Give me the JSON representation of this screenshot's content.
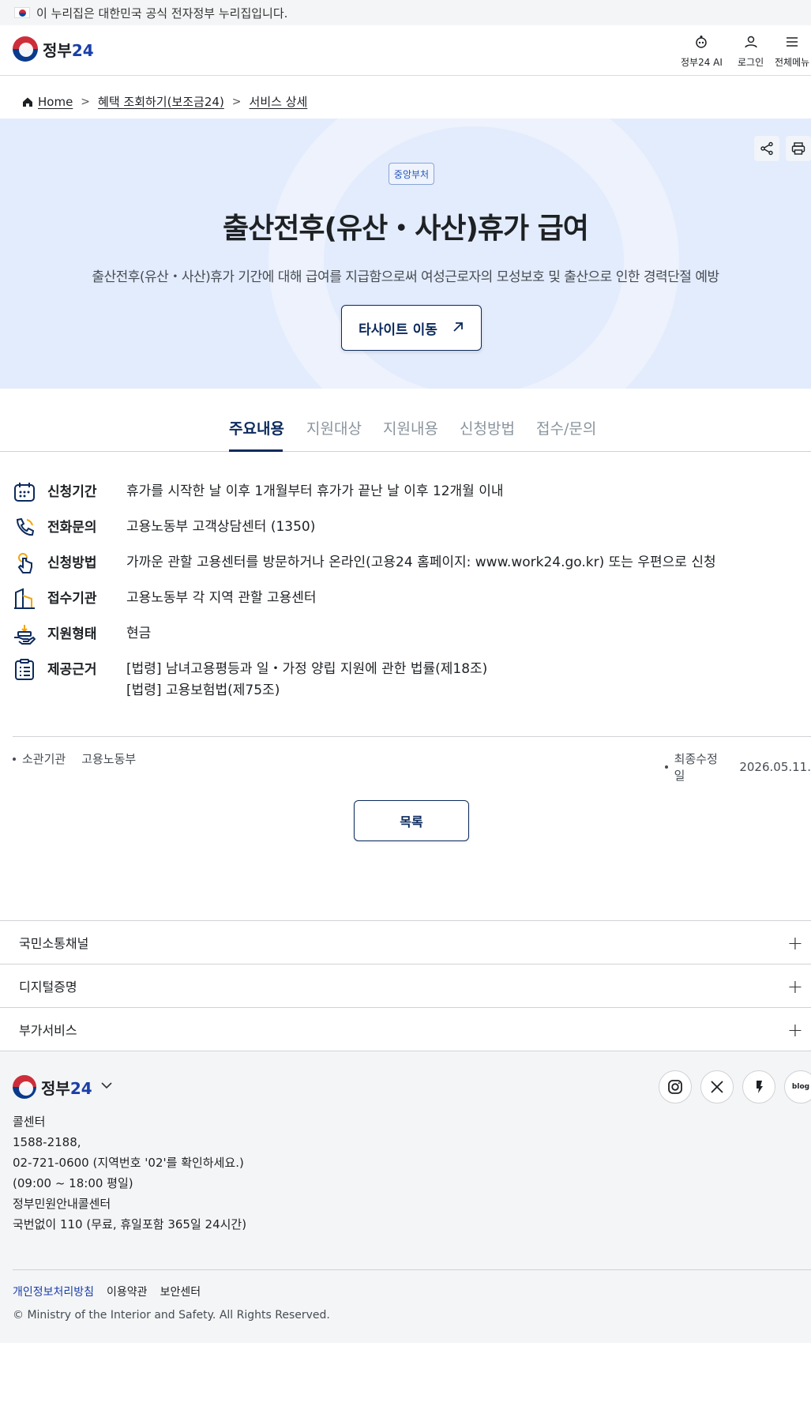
{
  "topbar": {
    "text": "이 누리집은 대한민국 공식 전자정부 누리집입니다."
  },
  "header": {
    "logo_text": "정부",
    "logo_num": "24",
    "ai_label": "정부24 AI",
    "login_label": "로그인",
    "menu_label": "전체메뉴"
  },
  "breadcrumb": {
    "home": "Home",
    "item1": "혜택 조회하기(보조금24)",
    "item2": "서비스 상세"
  },
  "hero": {
    "badge": "중앙부처",
    "title": "출산전후(유산・사산)휴가 급여",
    "description": "출산전후(유산・사산)휴가 기간에 대해 급여를 지급함으로써 여성근로자의 모성보호 및 출산으로 인한 경력단절 예방",
    "button_label": "타사이트 이동"
  },
  "tabs": [
    {
      "label": "주요내용"
    },
    {
      "label": "지원대상"
    },
    {
      "label": "지원내용"
    },
    {
      "label": "신청방법"
    },
    {
      "label": "접수/문의"
    }
  ],
  "info": [
    {
      "label": "신청기간",
      "value": "휴가를 시작한 날 이후 1개월부터 휴가가 끝난 날 이후 12개월 이내"
    },
    {
      "label": "전화문의",
      "value": "고용노동부 고객상담센터 (1350)"
    },
    {
      "label": "신청방법",
      "value": "가까운 관할 고용센터를 방문하거나 온라인(고용24 홈페이지: www.work24.go.kr) 또는 우편으로 신청"
    },
    {
      "label": "접수기관",
      "value": "고용노동부 각 지역 관할 고용센터"
    },
    {
      "label": "지원형태",
      "value": "현금"
    },
    {
      "label": "제공근거",
      "value": "[법령] 남녀고용평등과 일・가정 양립 지원에 관한 법률(제18조)",
      "value2": "[법령] 고용보험법(제75조)"
    }
  ],
  "meta": {
    "agency_label": "소관기관",
    "agency_value": "고용노동부",
    "updated_label": "최종수정일",
    "updated_value": "2026.05.11."
  },
  "list_button": "목록",
  "accordion": [
    {
      "label": "국민소통채널"
    },
    {
      "label": "디지털증명"
    },
    {
      "label": "부가서비스"
    }
  ],
  "footer": {
    "social_blog": "blog",
    "callcenter_title": "콜센터",
    "callcenter_line1": "1588-2188,",
    "callcenter_line2": "02-721-0600 (지역번호 '02'를 확인하세요.)",
    "callcenter_hours": "(09:00 ~ 18:00 평일)",
    "gov_title": "정부민원안내콜센터",
    "gov_line": "국번없이 110 (무료, 휴일포함 365일 24시간)",
    "links": [
      "개인정보처리방침",
      "이용약관",
      "보안센터"
    ],
    "copyright": "© Ministry of the Interior and Safety. All Rights Reserved."
  },
  "colors": {
    "accent": "#0b2a5c",
    "hero_bg": "#e3ecfc",
    "brand_blue": "#1a3fa8",
    "brand_red": "#cd2e3a"
  }
}
